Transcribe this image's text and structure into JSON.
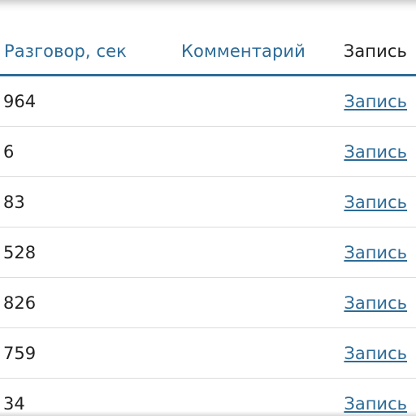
{
  "table": {
    "columns": {
      "talk": "Разговор, сек",
      "comment": "Комментарий",
      "record": "Запись"
    },
    "rows": [
      {
        "talk_seconds": "964",
        "comment": "",
        "record_link": "Запись"
      },
      {
        "talk_seconds": "6",
        "comment": "",
        "record_link": "Запись"
      },
      {
        "talk_seconds": "83",
        "comment": "",
        "record_link": "Запись"
      },
      {
        "talk_seconds": "528",
        "comment": "",
        "record_link": "Запись"
      },
      {
        "talk_seconds": "826",
        "comment": "",
        "record_link": "Запись"
      },
      {
        "talk_seconds": "759",
        "comment": "",
        "record_link": "Запись"
      },
      {
        "talk_seconds": "34",
        "comment": "",
        "record_link": "Запись"
      }
    ]
  },
  "colors": {
    "accent": "#2d6b97",
    "text": "#222222",
    "row_divider": "#dcdcdc"
  }
}
